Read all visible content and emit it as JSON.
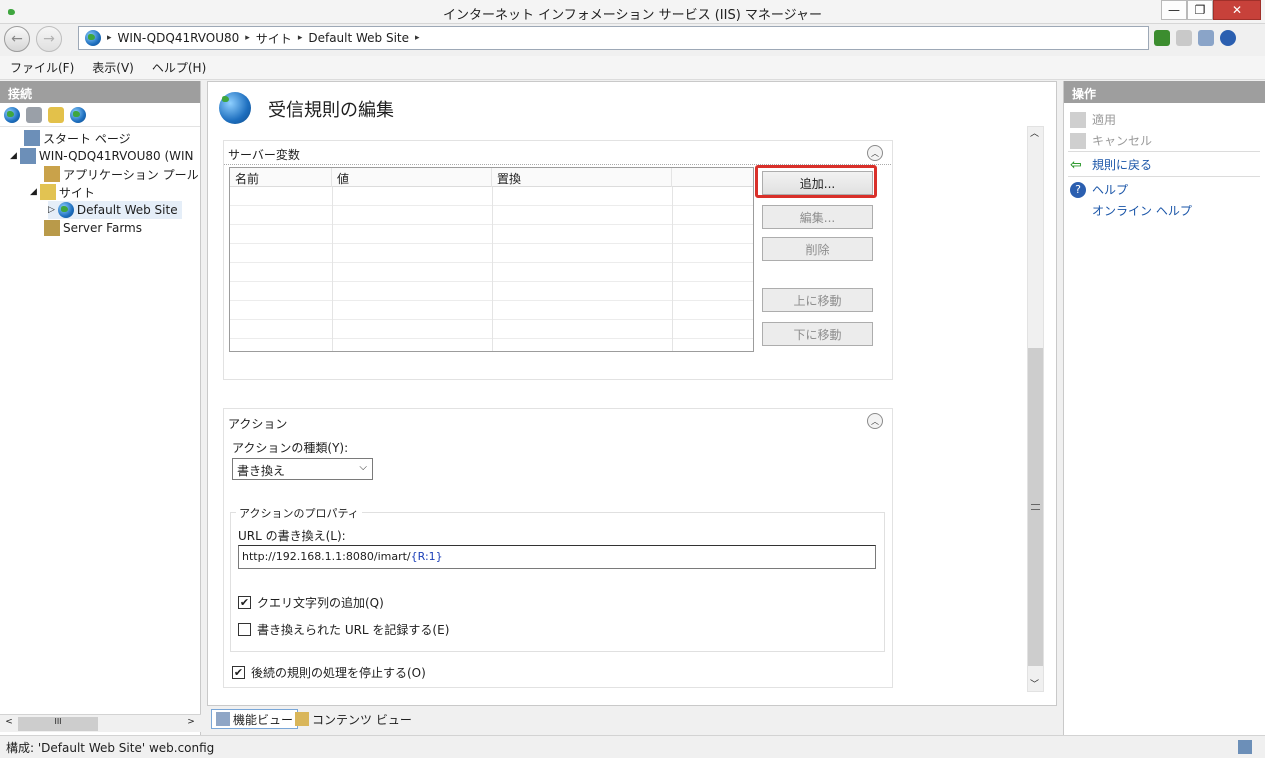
{
  "window": {
    "title": "インターネット インフォメーション サービス (IIS) マネージャー",
    "minimize_glyph": "—",
    "maximize_glyph": "❐",
    "close_glyph": "✕"
  },
  "address": {
    "crumbs": [
      "WIN-QDQ41RVOU80",
      "サイト",
      "Default Web Site"
    ],
    "sep": "▸"
  },
  "menu": {
    "file": "ファイル(F)",
    "view": "表示(V)",
    "help": "ヘルプ(H)"
  },
  "connections": {
    "header": "接続",
    "tree": {
      "start_page": "スタート ページ",
      "server": "WIN-QDQ41RVOU80 (WIN",
      "app_pools": "アプリケーション プール",
      "sites": "サイト",
      "default_site": "Default Web Site",
      "server_farms": "Server Farms"
    },
    "hscroll_thumb": "III"
  },
  "center": {
    "page_title": "受信規則の編集",
    "server_vars": {
      "header": "サーバー変数",
      "columns": [
        "名前",
        "値",
        "置換"
      ],
      "buttons": {
        "add": "追加...",
        "edit": "編集...",
        "remove": "削除",
        "move_up": "上に移動",
        "move_down": "下に移動"
      }
    },
    "action": {
      "header": "アクション",
      "type_label": "アクションの種類(Y):",
      "type_value": "書き換え",
      "props_label": "アクションのプロパティ",
      "url_label": "URL の書き換え(L):",
      "url_prefix": "http://192.168.1.1:8080/imart/",
      "url_var": "{R:1}",
      "append_query_label": "クエリ文字列の追加(Q)",
      "append_query_checked": true,
      "log_rewritten_label": "書き換えられた URL を記録する(E)",
      "log_rewritten_checked": false,
      "stop_processing_label": "後続の規則の処理を停止する(O)",
      "stop_processing_checked": true
    },
    "view_tabs": {
      "features": "機能ビュー",
      "content": "コンテンツ ビュー"
    }
  },
  "actions_panel": {
    "header": "操作",
    "apply": "適用",
    "cancel": "キャンセル",
    "back_to_rules": "規則に戻る",
    "help": "ヘルプ",
    "online_help": "オンライン ヘルプ"
  },
  "status": {
    "text": "構成: 'Default Web Site' web.config"
  }
}
